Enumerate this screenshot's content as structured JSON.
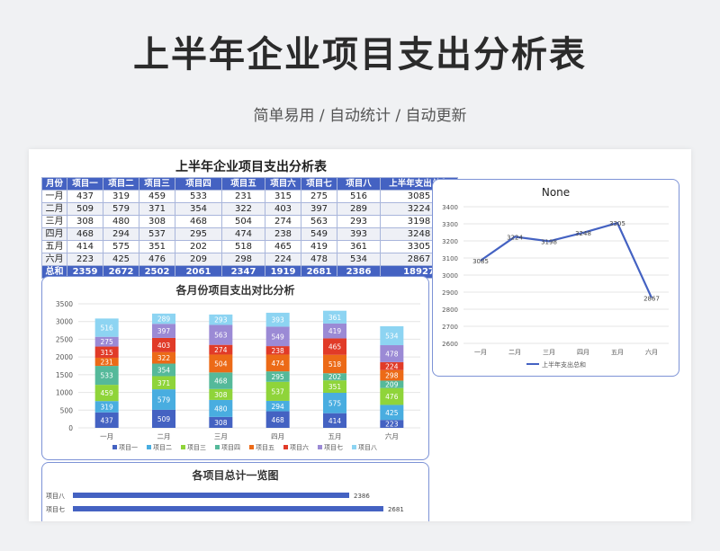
{
  "page": {
    "title": "上半年企业项目支出分析表",
    "subtitle": "简单易用 / 自动统计 / 自动更新"
  },
  "table": {
    "title": "上半年企业项目支出分析表",
    "headers": [
      "月份",
      "项目一",
      "项目二",
      "项目三",
      "项目四",
      "项目五",
      "项目六",
      "项目七",
      "项目八",
      "上半年支出总和"
    ],
    "rows": [
      [
        "一月",
        "437",
        "319",
        "459",
        "533",
        "231",
        "315",
        "275",
        "516",
        "3085"
      ],
      [
        "二月",
        "509",
        "579",
        "371",
        "354",
        "322",
        "403",
        "397",
        "289",
        "3224"
      ],
      [
        "三月",
        "308",
        "480",
        "308",
        "468",
        "504",
        "274",
        "563",
        "293",
        "3198"
      ],
      [
        "四月",
        "468",
        "294",
        "537",
        "295",
        "474",
        "238",
        "549",
        "393",
        "3248"
      ],
      [
        "五月",
        "414",
        "575",
        "351",
        "202",
        "518",
        "465",
        "419",
        "361",
        "3305"
      ],
      [
        "六月",
        "223",
        "425",
        "476",
        "209",
        "298",
        "224",
        "478",
        "534",
        "2867"
      ]
    ],
    "total": [
      "总和",
      "2359",
      "2672",
      "2502",
      "2061",
      "2347",
      "1919",
      "2681",
      "2386",
      "18927"
    ]
  },
  "colors": {
    "header": "#4462c2",
    "series": [
      "#4462c2",
      "#49ade0",
      "#8fd43a",
      "#55b99a",
      "#ec6a17",
      "#e13b28",
      "#9b8ad5",
      "#8dd4f2"
    ],
    "line": "#4462c2"
  },
  "chart_data": [
    {
      "type": "bar",
      "stacked": true,
      "title": "各月份项目支出对比分析",
      "categories": [
        "一月",
        "二月",
        "三月",
        "四月",
        "五月",
        "六月"
      ],
      "series": [
        {
          "name": "项目一",
          "values": [
            437,
            509,
            308,
            468,
            414,
            223
          ]
        },
        {
          "name": "项目二",
          "values": [
            319,
            579,
            480,
            294,
            575,
            425
          ]
        },
        {
          "name": "项目三",
          "values": [
            459,
            371,
            308,
            537,
            351,
            476
          ]
        },
        {
          "name": "项目四",
          "values": [
            533,
            354,
            468,
            295,
            202,
            209
          ]
        },
        {
          "name": "项目五",
          "values": [
            231,
            322,
            504,
            474,
            518,
            298
          ]
        },
        {
          "name": "项目六",
          "values": [
            315,
            403,
            274,
            238,
            465,
            224
          ]
        },
        {
          "name": "项目七",
          "values": [
            275,
            397,
            563,
            549,
            419,
            478
          ]
        },
        {
          "name": "项目八",
          "values": [
            516,
            289,
            293,
            393,
            361,
            534
          ]
        }
      ],
      "ylim": [
        0,
        3500
      ],
      "yticks": [
        "0",
        "500",
        "1000",
        "1500",
        "2000",
        "2500",
        "3000",
        "3500"
      ],
      "legend": "bottom",
      "grid": true
    },
    {
      "type": "line",
      "title": "None",
      "categories": [
        "一月",
        "二月",
        "三月",
        "四月",
        "五月",
        "六月"
      ],
      "series": [
        {
          "name": "上半年支出总和",
          "values": [
            3085,
            3224,
            3198,
            3248,
            3305,
            2867
          ]
        }
      ],
      "ylim": [
        2600,
        3400
      ],
      "yticks": [
        "2600",
        "2700",
        "2800",
        "2900",
        "3000",
        "3100",
        "3200",
        "3300",
        "3400"
      ],
      "legend": "bottom",
      "grid": true
    },
    {
      "type": "bar",
      "orientation": "horizontal",
      "title": "各项目总计一览图",
      "categories": [
        "项目八",
        "项目七"
      ],
      "values": [
        2386,
        2681
      ],
      "max": 3000
    }
  ]
}
